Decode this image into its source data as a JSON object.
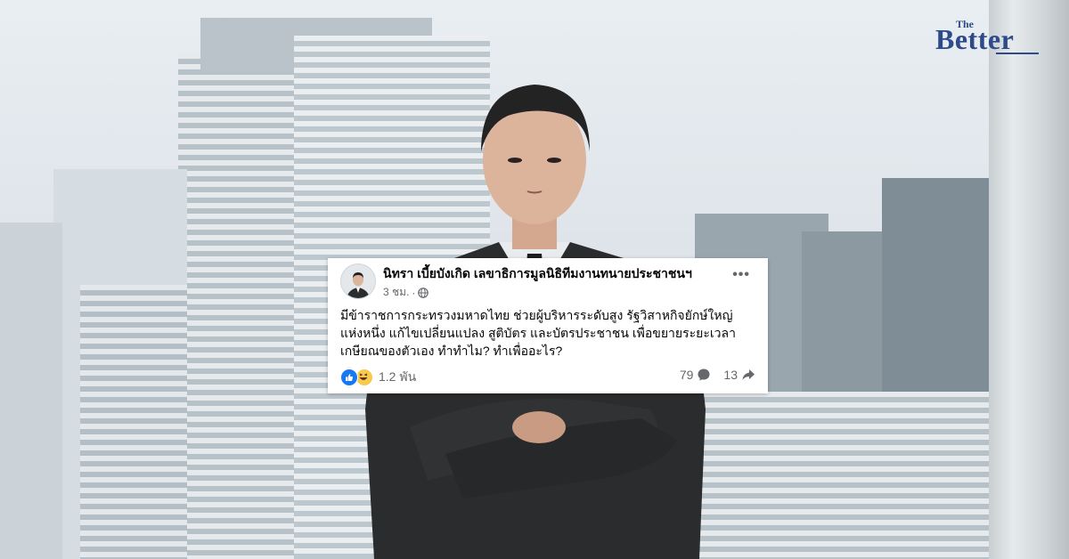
{
  "brand": {
    "logo_top": "The",
    "logo_main": "Better",
    "color": "#2d4a8a"
  },
  "post": {
    "author": "นิทรา เบี้ยบังเกิด เลขาธิการมูลนิธิทีมงานทนายประชาชนฯ",
    "time": "3 ชม.",
    "separator": "·",
    "privacy_icon": "globe-icon",
    "more_icon": "more-options-icon",
    "more_label": "•••",
    "text_lines": [
      "มีข้าราชการกระทรวงมหาดไทย ช่วยผู้บริหารระดับสูง รัฐวิสาหกิจยักษ์ใหญ่",
      "แห่งหนึ่ง แก้ไขเปลี่ยนแปลง สูติบัตร และบัตรประชาชน เพื่อขยายระยะเวลา",
      "เกษียณของตัวเอง ทำทำไม? ทำเพื่ออะไร?"
    ],
    "reactions": {
      "icons": [
        "like-icon",
        "haha-icon"
      ],
      "count": "1.2 พัน"
    },
    "comments": {
      "count": "79",
      "icon": "comment-icon"
    },
    "shares": {
      "count": "13",
      "icon": "share-icon"
    },
    "accent": "#1877f2"
  }
}
